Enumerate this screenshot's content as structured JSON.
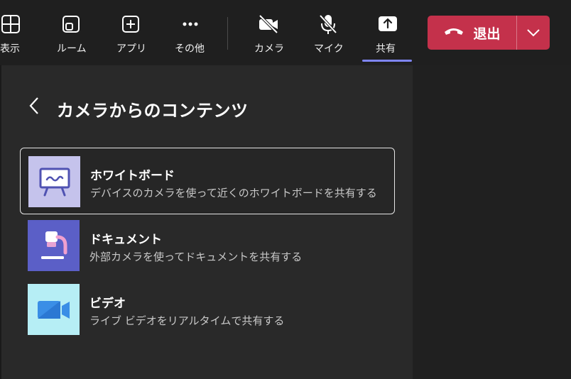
{
  "toolbar": {
    "buttons": [
      {
        "label": "表示",
        "icon": "grid-view-icon"
      },
      {
        "label": "ルーム",
        "icon": "breakout-rooms-icon"
      },
      {
        "label": "アプリ",
        "icon": "add-app-icon"
      },
      {
        "label": "その他",
        "icon": "more-icon"
      },
      {
        "label": "カメラ",
        "icon": "camera-off-icon"
      },
      {
        "label": "マイク",
        "icon": "mic-off-icon"
      },
      {
        "label": "共有",
        "icon": "share-icon"
      }
    ],
    "leave_label": "退出"
  },
  "panel": {
    "title": "カメラからのコンテンツ",
    "options": [
      {
        "title": "ホワイトボード",
        "description": "デバイスのカメラを使って近くのホワイトボードを共有する",
        "selected": true
      },
      {
        "title": "ドキュメント",
        "description": "外部カメラを使ってドキュメントを共有する",
        "selected": false
      },
      {
        "title": "ビデオ",
        "description": "ライブ ビデオをリアルタイムで共有する",
        "selected": false
      }
    ]
  },
  "colors": {
    "leave_red": "#c4314b",
    "share_accent": "#7f85f5",
    "whiteboard_bg": "#c5c3ec",
    "document_bg": "#5b5fc7",
    "video_bg": "#b6eef5"
  }
}
